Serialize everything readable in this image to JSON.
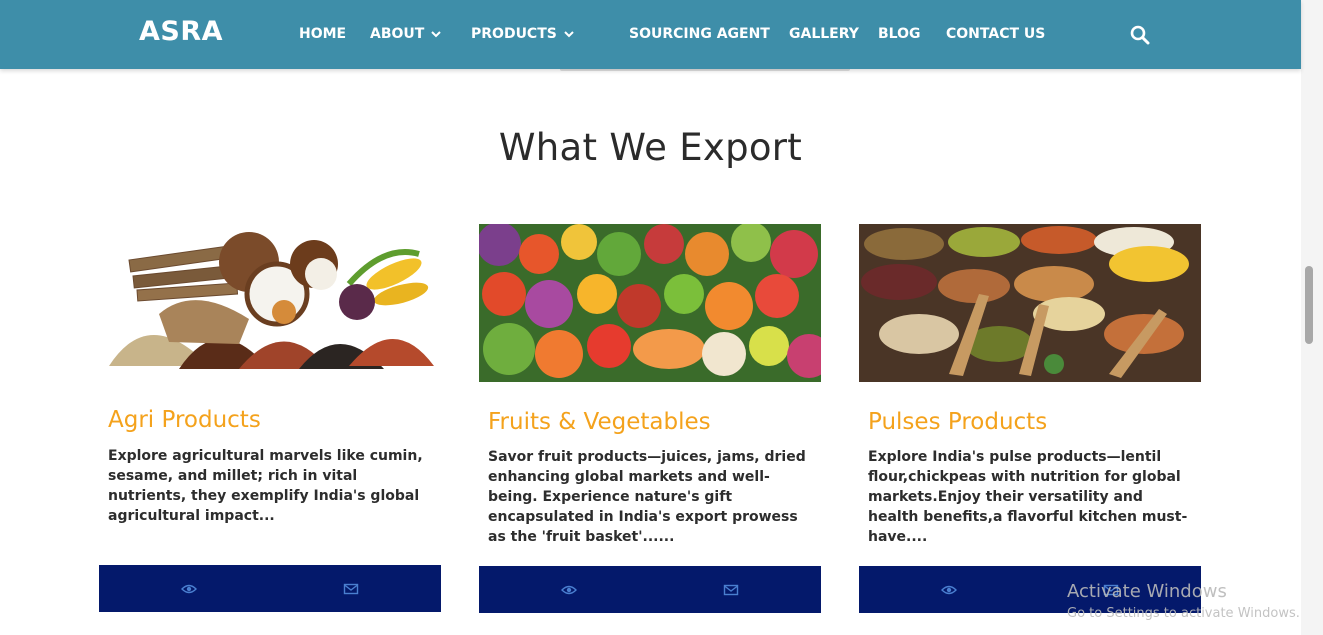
{
  "nav": {
    "brand": "ASRA",
    "items": [
      {
        "label": "HOME"
      },
      {
        "label": "ABOUT"
      },
      {
        "label": "PRODUCTS"
      },
      {
        "label": "SOURCING AGENT"
      },
      {
        "label": "GALLERY"
      },
      {
        "label": "BLOG"
      },
      {
        "label": "CONTACT US"
      }
    ],
    "search_icon": "search-icon"
  },
  "section": {
    "title": "What We Export"
  },
  "cards": [
    {
      "title": "Agri Products",
      "description": "Explore agricultural marvels like cumin, sesame, and millet; rich in vital nutrients, they exemplify India's global agricultural impact...",
      "image": "agri-products-image",
      "icons": [
        "eye-icon",
        "envelope-icon"
      ]
    },
    {
      "title": "Fruits & Vegetables",
      "description": "Savor fruit products—juices, jams, dried enhancing global markets and well-being. Experience nature's gift encapsulated in India's export prowess as the 'fruit basket'......",
      "image": "fruits-vegetables-image",
      "icons": [
        "eye-icon",
        "envelope-icon"
      ]
    },
    {
      "title": "Pulses Products",
      "description": "Explore India's pulse products—lentil flour,chickpeas with nutrition for global markets.Enjoy their versatility and health benefits,a flavorful kitchen must-have....",
      "image": "pulses-products-image",
      "icons": [
        "eye-icon",
        "envelope-icon"
      ]
    }
  ],
  "watermark": {
    "line1": "Activate Windows",
    "line2": "Go to Settings to activate Windows."
  },
  "colors": {
    "navbar": "#3e8ea9",
    "card_title": "#f4a21c",
    "card_bar": "#04196b"
  }
}
